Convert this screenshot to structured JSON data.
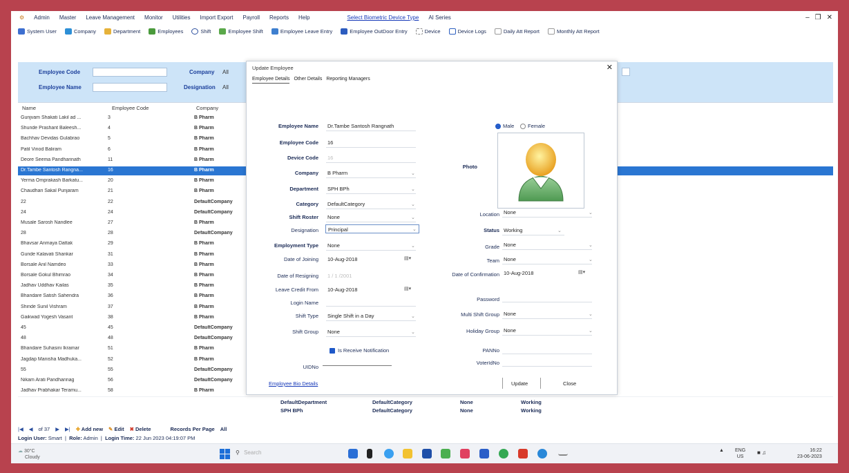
{
  "menu": {
    "items": [
      "Admin",
      "Master",
      "Leave Management",
      "Monitor",
      "Utilities",
      "Import Export",
      "Payroll",
      "Reports",
      "Help"
    ],
    "device_type_link": "Select Biometric Device Type",
    "device_type_value": "AI Series"
  },
  "toolbar": {
    "items": [
      "System User",
      "Company",
      "Department",
      "Employees",
      "Shift",
      "Employee Shift",
      "Employee Leave Entry",
      "Employee OutDoor Entry",
      "Device",
      "Device Logs",
      "Daily Att Report",
      "Monthly Att Report"
    ]
  },
  "filter": {
    "employee_code_label": "Employee Code",
    "employee_name_label": "Employee Name",
    "company_label": "Company",
    "company_value": "All",
    "designation_label": "Designation",
    "designation_value": "All"
  },
  "grid": {
    "headers": [
      "Name",
      "Employee Code",
      "Company"
    ],
    "rows": [
      {
        "name": "Gunjvam Shakati Lakil ad ...",
        "code": "3",
        "company": "B Pharm"
      },
      {
        "name": "Shunde Prashant Baleesh...",
        "code": "4",
        "company": "B Pharm"
      },
      {
        "name": "Bachhav Devidas Gulabrao",
        "code": "5",
        "company": "B Pharm"
      },
      {
        "name": "Patil Vinod Baliram",
        "code": "6",
        "company": "B Pharm"
      },
      {
        "name": "Deore Seema Pandharinath",
        "code": "11",
        "company": "B Pharm"
      },
      {
        "name": "Dr.Tambe Santosh Rangna...",
        "code": "16",
        "company": "B Pharm"
      },
      {
        "name": "Yerma Omprakash Barkatu...",
        "code": "20",
        "company": "B Pharm"
      },
      {
        "name": "Chaudhari Sakal Punjaram",
        "code": "21",
        "company": "B Pharm"
      },
      {
        "name": "22",
        "code": "22",
        "company": "DefaultCompany"
      },
      {
        "name": "24",
        "code": "24",
        "company": "DefaultCompany"
      },
      {
        "name": "Musale Sarosh Nandlee",
        "code": "27",
        "company": "B Pharm"
      },
      {
        "name": "28",
        "code": "28",
        "company": "DefaultCompany"
      },
      {
        "name": "Bhavsar Anmaya Dattak",
        "code": "29",
        "company": "B Pharm"
      },
      {
        "name": "Gunde Kalavati Shankar",
        "code": "31",
        "company": "B Pharm"
      },
      {
        "name": "Borsale Anil Namdeo",
        "code": "33",
        "company": "B Pharm"
      },
      {
        "name": "Borsale Gokul Bhimrao",
        "code": "34",
        "company": "B Pharm"
      },
      {
        "name": "Jadhav Uddhav Kailas",
        "code": "35",
        "company": "B Pharm"
      },
      {
        "name": "Bhandare Satish Sahendra",
        "code": "36",
        "company": "B Pharm"
      },
      {
        "name": "Shinde Sunil Vishram",
        "code": "37",
        "company": "B Pharm"
      },
      {
        "name": "Gaikwad Yogesh Vasant",
        "code": "38",
        "company": "B Pharm"
      },
      {
        "name": "45",
        "code": "45",
        "company": "DefaultCompany"
      },
      {
        "name": "48",
        "code": "48",
        "company": "DefaultCompany"
      },
      {
        "name": "Bhandare Suhasini Ikramar",
        "code": "51",
        "company": "B Pharm"
      },
      {
        "name": "Jagdap Manisha Madhuka...",
        "code": "52",
        "company": "B Pharm"
      },
      {
        "name": "55",
        "code": "55",
        "company": "DefaultCompany"
      },
      {
        "name": "Nikam Arati Pandharinag",
        "code": "56",
        "company": "DefaultCompany"
      },
      {
        "name": "Jadhav Prabhakar Teramu...",
        "code": "58",
        "company": "B Pharm"
      }
    ],
    "under_rows": [
      {
        "department": "DefaultDepartment",
        "category": "DefaultCategory",
        "shift": "None",
        "status": "Working"
      },
      {
        "department": "SPH BPh",
        "category": "DefaultCategory",
        "shift": "None",
        "status": "Working"
      }
    ]
  },
  "pager": {
    "of_label": "of 37",
    "add_new": "Add new",
    "edit": "Edit",
    "delete": "Delete",
    "records_per_page_label": "Records Per Page",
    "records_per_page_value": "All"
  },
  "status": {
    "login_user_label": "Login User:",
    "login_user_value": "Smart",
    "role_label": "Role:",
    "role_value": "Admin",
    "login_time_label": "Login Time:",
    "login_time_value": "22 Jun 2023 04:19:07 PM"
  },
  "taskbar": {
    "weather_temp": "30°C",
    "weather_desc": "Cloudy",
    "search_placeholder": "Search",
    "lang_top": "ENG",
    "lang_bottom": "US",
    "time": "16:22",
    "date": "23-06-2023"
  },
  "dialog": {
    "title": "Update Employee",
    "tabs": [
      "Employee Details",
      "Other Details",
      "Reporting Managers"
    ],
    "gender_male": "Male",
    "gender_female": "Female",
    "photo_label": "Photo",
    "fields": {
      "employee_name": {
        "label": "Employee Name",
        "value": "Dr.Tambe Santosh Rangnath"
      },
      "employee_code": {
        "label": "Employee Code",
        "value": "16"
      },
      "device_code": {
        "label": "Device Code",
        "value": "16"
      },
      "company": {
        "label": "Company",
        "value": "B Pharm"
      },
      "department": {
        "label": "Department",
        "value": "SPH BPh"
      },
      "category": {
        "label": "Category",
        "value": "DefaultCategory"
      },
      "shift_roster": {
        "label": "Shift Roster",
        "value": "None"
      },
      "designation": {
        "label": "Designation",
        "value": "Principal"
      },
      "employment_type": {
        "label": "Employment Type",
        "value": "None"
      },
      "date_of_joining": {
        "label": "Date of Joining",
        "value": "10-Aug-2018"
      },
      "date_of_resigning": {
        "label": "Date of Resigning",
        "value": "1 / 1 /2001"
      },
      "leave_credit_from": {
        "label": "Leave Credit From",
        "value": "10-Aug-2018"
      },
      "login_name": {
        "label": "Login Name",
        "value": ""
      },
      "shift_type": {
        "label": "Shift Type",
        "value": "Single Shift in a Day"
      },
      "shift_group": {
        "label": "Shift Group",
        "value": "None"
      },
      "uid": {
        "label": "UIDNo",
        "value": ""
      },
      "location": {
        "label": "Location",
        "value": "None"
      },
      "status": {
        "label": "Status",
        "value": "Working"
      },
      "grade": {
        "label": "Grade",
        "value": "None"
      },
      "team": {
        "label": "Team",
        "value": "None"
      },
      "date_of_confirmation": {
        "label": "Date of Confirmation",
        "value": "10-Aug-2018"
      },
      "password": {
        "label": "Password",
        "value": ""
      },
      "multi_shift_group": {
        "label": "Multi Shift Group",
        "value": "None"
      },
      "holiday_group": {
        "label": "Holiday Group",
        "value": "None"
      },
      "pan": {
        "label": "PANNo",
        "value": ""
      },
      "voter_id": {
        "label": "VoterIdNo",
        "value": ""
      }
    },
    "notification_label": "Is Receive Notification",
    "employee_bio_link": "Employee Bio Details",
    "update_button": "Update",
    "close_button": "Close"
  },
  "colors": {
    "frame": "#b8424e",
    "filter_bg": "#cde4f8",
    "selection": "#2a76d2",
    "accent": "#1e58c8"
  }
}
